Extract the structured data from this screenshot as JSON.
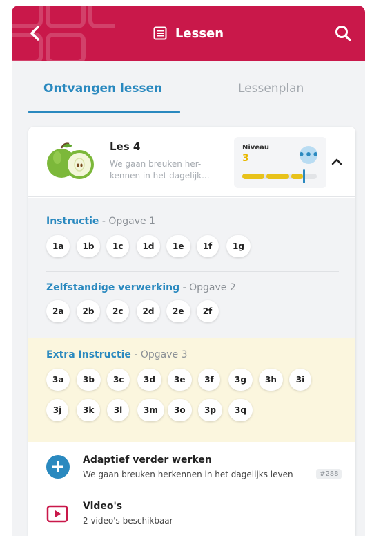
{
  "header": {
    "title": "Lessen",
    "back_icon": "chevron-left-icon",
    "list_icon": "list-icon",
    "search_icon": "search-icon",
    "color": "#c9184a"
  },
  "tabs": [
    {
      "label": "Ontvangen lessen",
      "active": true
    },
    {
      "label": "Lessenplan",
      "active": false
    }
  ],
  "lesson": {
    "title": "Les 4",
    "description": "We gaan breuken her- kennen in het dagelijk...",
    "niveau_label": "Niveau",
    "niveau_value": "3",
    "niveau_progress": 0.82,
    "more_icon": "more-dots-icon",
    "collapse_icon": "chevron-up-icon"
  },
  "sections": [
    {
      "name": "Instructie",
      "subtitle": "Opgave 1",
      "items": [
        "1a",
        "1b",
        "1c",
        "1d",
        "1e",
        "1f",
        "1g"
      ]
    },
    {
      "name": "Zelfstandige verwerking",
      "subtitle": "Opgave 2",
      "items": [
        "2a",
        "2b",
        "2c",
        "2d",
        "2e",
        "2f"
      ]
    },
    {
      "name": "Extra Instructie",
      "subtitle": "Opgave 3",
      "items": [
        "3a",
        "3b",
        "3c",
        "3d",
        "3e",
        "3f",
        "3g",
        "3h",
        "3i",
        "3j",
        "3k",
        "3l",
        "3m",
        "3o",
        "3p",
        "3q"
      ]
    }
  ],
  "separator": "-",
  "adaptive": {
    "title": "Adaptief verder werken",
    "subtitle": "We gaan breuken herkennen in het dagelijks leven",
    "tag": "#288",
    "icon": "plus-icon"
  },
  "videos": {
    "title": "Video's",
    "subtitle": "2 video's beschikbaar",
    "icon": "play-icon"
  },
  "colors": {
    "accent": "#2a89bf",
    "level": "#e8c21a",
    "extra_bg": "#fbf6de"
  }
}
